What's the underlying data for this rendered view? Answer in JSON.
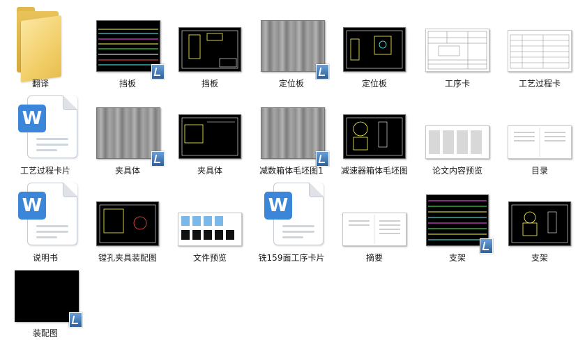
{
  "files": [
    {
      "name": "翻译",
      "kind": "folder"
    },
    {
      "name": "挡板",
      "kind": "cad_dense"
    },
    {
      "name": "挡板",
      "kind": "cad"
    },
    {
      "name": "定位板",
      "kind": "gray"
    },
    {
      "name": "定位板",
      "kind": "cad"
    },
    {
      "name": "工序卡",
      "kind": "paper_table"
    },
    {
      "name": "工艺过程卡",
      "kind": "paper_table"
    },
    {
      "name": "工艺过程卡片",
      "kind": "word"
    },
    {
      "name": "夹具体",
      "kind": "gray"
    },
    {
      "name": "夹具体",
      "kind": "cad"
    },
    {
      "name": "减数箱体毛坯图1",
      "kind": "gray"
    },
    {
      "name": "减速器箱体毛坯图",
      "kind": "cad"
    },
    {
      "name": "论文内容预览",
      "kind": "paper_multi"
    },
    {
      "name": "目录",
      "kind": "paper_doc"
    },
    {
      "name": "说明书",
      "kind": "word"
    },
    {
      "name": "镗孔夹具装配图",
      "kind": "cad"
    },
    {
      "name": "文件预览",
      "kind": "preview_grid"
    },
    {
      "name": "铣159面工序卡片",
      "kind": "word"
    },
    {
      "name": "摘要",
      "kind": "paper_doc"
    },
    {
      "name": "支架",
      "kind": "cad_dense"
    },
    {
      "name": "支架",
      "kind": "cad"
    },
    {
      "name": "装配图",
      "kind": "black"
    }
  ]
}
